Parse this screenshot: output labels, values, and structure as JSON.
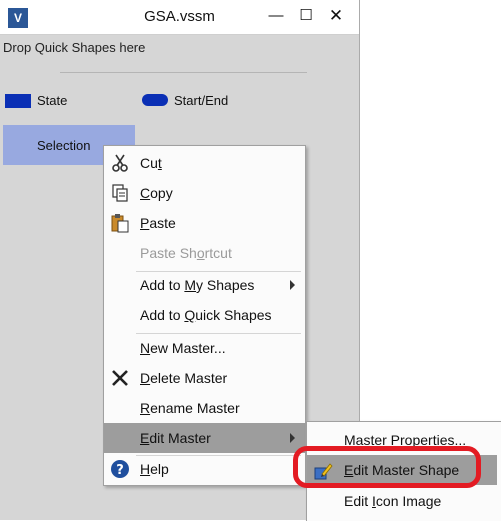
{
  "window": {
    "title": "GSA.vssm",
    "app_icon_letter": "V",
    "minimize_glyph": "—",
    "maximize_glyph": "☐",
    "close_glyph": "✕"
  },
  "stencil": {
    "drop_label": "Drop Quick Shapes here",
    "shapes": [
      {
        "label": "State",
        "color": "#0a2fb5"
      },
      {
        "label": "Start/End",
        "color": "#0a2fb5"
      }
    ],
    "selection_label": "Selection",
    "selection_color": "#98a9e0"
  },
  "context_menu": {
    "items": [
      {
        "pre": "Cu",
        "u": "t",
        "post": "",
        "icon": "scissors-icon"
      },
      {
        "pre": "",
        "u": "C",
        "post": "opy",
        "icon": "copy-icon"
      },
      {
        "pre": "",
        "u": "P",
        "post": "aste",
        "icon": "paste-icon"
      },
      {
        "pre": "Paste Sh",
        "u": "o",
        "post": "rtcut",
        "disabled": true
      },
      {
        "pre": "Add to ",
        "u": "M",
        "post": "y Shapes",
        "submenu": true
      },
      {
        "pre": "Add to ",
        "u": "Q",
        "post": "uick Shapes"
      },
      {
        "pre": "",
        "u": "N",
        "post": "ew Master..."
      },
      {
        "pre": "",
        "u": "D",
        "post": "elete Master",
        "icon": "delete-x-icon"
      },
      {
        "pre": "",
        "u": "R",
        "post": "ename Master"
      },
      {
        "pre": "",
        "u": "E",
        "post": "dit Master",
        "submenu": true,
        "highlighted": true
      },
      {
        "pre": "",
        "u": "H",
        "post": "elp",
        "icon": "help-icon"
      }
    ]
  },
  "submenu": {
    "items": [
      {
        "pre": "Master Propert",
        "u": "i",
        "post": "es..."
      },
      {
        "pre": "",
        "u": "E",
        "post": "dit Master Shape",
        "highlighted": true,
        "icon": "edit-shape-icon"
      },
      {
        "pre": "Edit ",
        "u": "I",
        "post": "con Image"
      }
    ]
  },
  "annotation_color": "#e31b23",
  "highlight_color": "#9d9d9d"
}
